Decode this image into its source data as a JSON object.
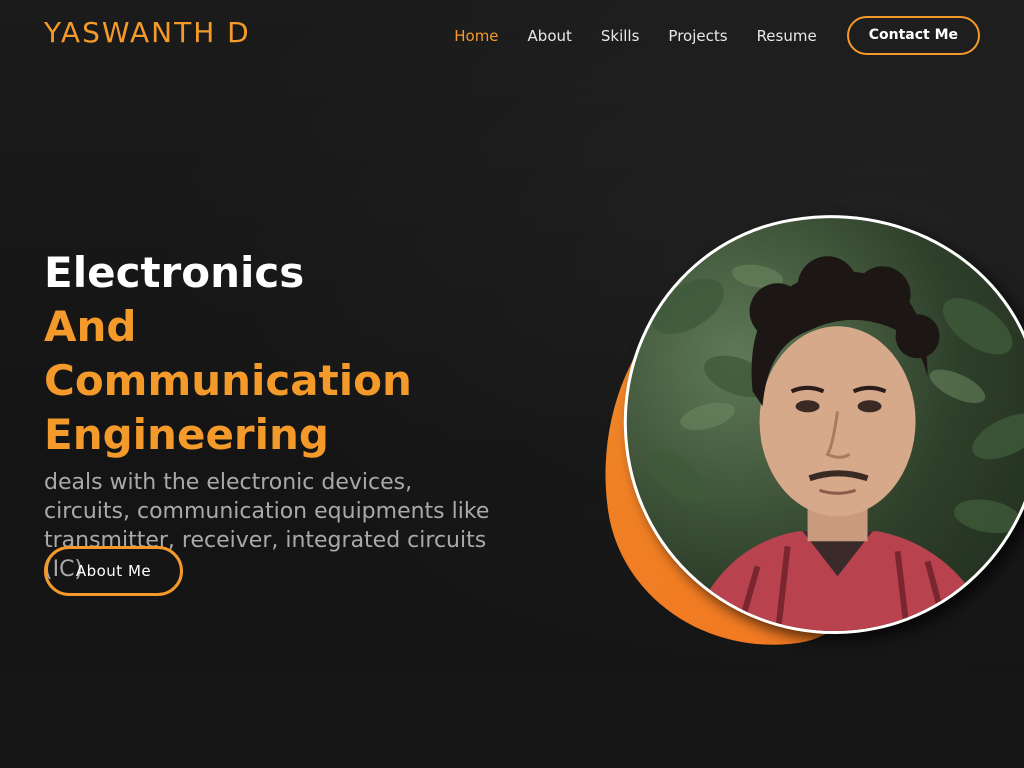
{
  "header": {
    "logo": "YASWANTH D",
    "nav": [
      {
        "label": "Home",
        "active": true
      },
      {
        "label": "About",
        "active": false
      },
      {
        "label": "Skills",
        "active": false
      },
      {
        "label": "Projects",
        "active": false
      },
      {
        "label": "Resume",
        "active": false
      }
    ],
    "contact_label": "Contact Me"
  },
  "hero": {
    "title_line1": "Electronics",
    "title_line2": "And Communication",
    "title_line3": "Engineering",
    "description": "deals with the electronic devices, circuits, communication equipments like transmitter, receiver, integrated circuits (IC)",
    "about_button": "About Me"
  },
  "colors": {
    "accent": "#f39a2b",
    "background": "#171717",
    "blob": "#f17a22"
  },
  "icons": {
    "portrait": "profile-photo"
  }
}
